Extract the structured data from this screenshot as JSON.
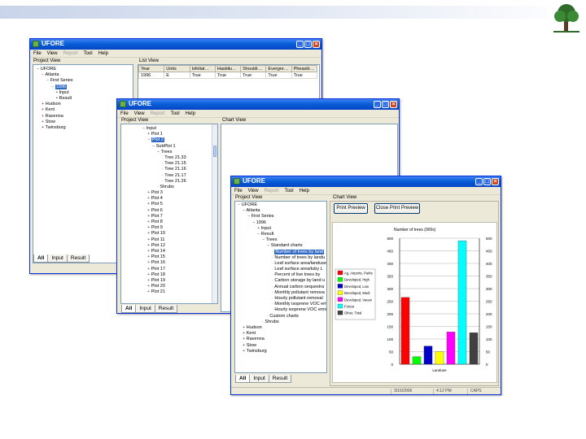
{
  "windows": [
    {
      "title": "UFORE",
      "menu": [
        "File",
        "View",
        "Report",
        "Tool",
        "Help"
      ],
      "menu_dim": [
        false,
        false,
        true,
        false,
        false
      ],
      "project_view_label": "Project View",
      "list_view_label": "List View",
      "tree": [
        "UFORE",
        "Atlanta",
        "First Series",
        "1996",
        "Input",
        "Result",
        "Hudson",
        "Kent",
        "Ravenna",
        "Stow",
        "Twinsburg"
      ],
      "table": {
        "headers": [
          "Year",
          "Units",
          "Isfoliat…",
          "Hasbilu…",
          "Shouldi…",
          "Evergre…",
          "Pheasib…"
        ],
        "rows": [
          [
            "1996",
            "E",
            "True",
            "True",
            "True",
            "True",
            "True"
          ]
        ]
      },
      "tabs": [
        "All",
        "Input",
        "Result"
      ]
    },
    {
      "title": "UFORE",
      "menu": [
        "File",
        "View",
        "Report",
        "Tool",
        "Help"
      ],
      "menu_dim": [
        false,
        false,
        true,
        false,
        false
      ],
      "project_view_label": "Project View",
      "chart_view_label": "Chart View",
      "tree": [
        "Input",
        "Plot 1",
        "Plot 2",
        "SubPlot 1",
        "Trees",
        "Tree 21.33",
        "Tree 21.15",
        "Tree 21.16",
        "Tree 21.17",
        "Tree 21.26",
        "Shrubs",
        "Plot 3",
        "Plot 4",
        "Plot 5",
        "Plot 6",
        "Plot 7",
        "Plot 8",
        "Plot 9",
        "Plot 10",
        "Plot 11",
        "Plot 12",
        "Plot 14",
        "Plot 15",
        "Plot 16",
        "Plot 17",
        "Plot 18",
        "Plot 19",
        "Plot 20",
        "Plot 21"
      ],
      "tabs": [
        "All",
        "Input",
        "Result"
      ]
    },
    {
      "title": "UFORE",
      "menu": [
        "File",
        "View",
        "Report",
        "Tool",
        "Help"
      ],
      "menu_dim": [
        false,
        false,
        true,
        false,
        false
      ],
      "project_view_label": "Project View",
      "chart_view_label": "Chart View",
      "tree": [
        "UFORE",
        "Atlanta",
        "First Series",
        "1996",
        "Input",
        "Result",
        "Trees",
        "Standard charts",
        "Number of trees by land",
        "Number of trees by landu",
        "Leaf surface area/landuse",
        "Leaf surface area/tuby L",
        "Percent of live trees by",
        "Carbon storage by land u",
        "Annual carbon sequestra",
        "Monthly pollutant remova",
        "Hourly pollutant removal",
        "Monthly isoprene VOC emi",
        "Hourly isoprene VOC emiss",
        "Custom charts",
        "Shrubs",
        "Hudson",
        "Kent",
        "Ravenna",
        "Stow",
        "Twinsburg"
      ],
      "buttons": [
        "Print Preview",
        "Close Print Preview"
      ],
      "tabs": [
        "All",
        "Input",
        "Result"
      ],
      "status": [
        "3/15/2006",
        "4:12 PM",
        "CAPS"
      ]
    }
  ],
  "chart_data": {
    "type": "bar",
    "title": "Number of trees (000s)",
    "xlabel": "Landuse",
    "ylim": [
      0,
      500
    ],
    "yticks": [
      0,
      50,
      100,
      150,
      200,
      250,
      300,
      350,
      400,
      450,
      500
    ],
    "series": [
      {
        "name": "Ag, Airports, Parks",
        "value": 265,
        "color": "#ff0000"
      },
      {
        "name": "Developed, High",
        "value": 30,
        "color": "#00ff00"
      },
      {
        "name": "Developed, Low",
        "value": 72,
        "color": "#0000cc"
      },
      {
        "name": "Developed, Medi",
        "value": 50,
        "color": "#ffff00"
      },
      {
        "name": "Developed, Vacan",
        "value": 128,
        "color": "#ff00ff"
      },
      {
        "name": "Forest",
        "value": 490,
        "color": "#00ffff"
      },
      {
        "name": "Other, Total",
        "value": 125,
        "color": "#404040"
      }
    ]
  }
}
